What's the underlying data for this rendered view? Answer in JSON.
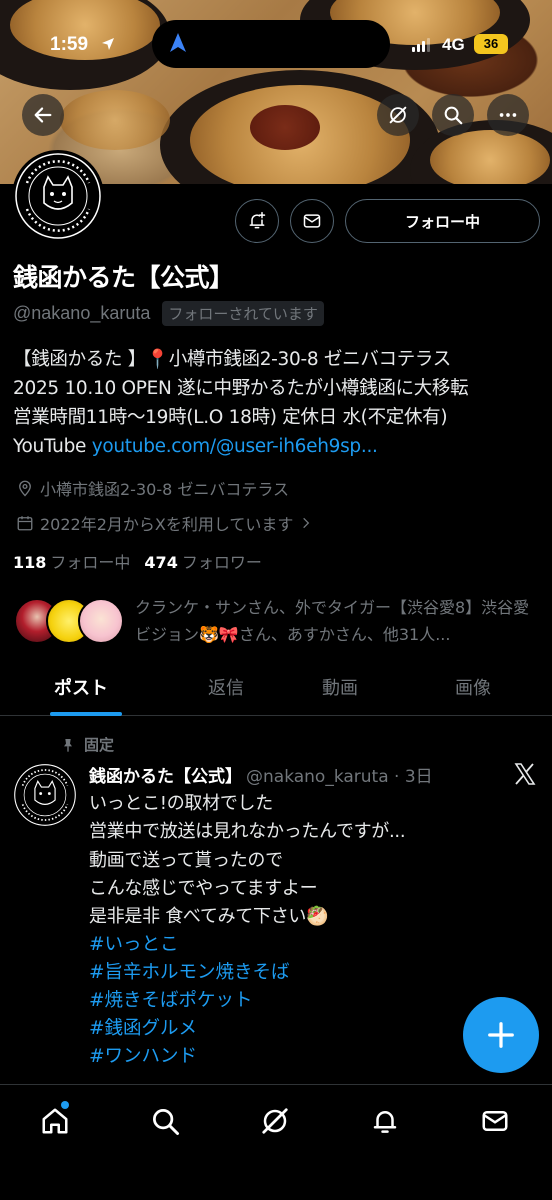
{
  "status": {
    "time": "1:59",
    "network": "4G",
    "battery": "36"
  },
  "profile": {
    "name": "銭函かるた【公式】",
    "handle": "@nakano_karuta",
    "follows_you": "フォローされています",
    "follow_button": "フォロー中",
    "bio": "【銭函かるた 】📍小樽市銭函2-30-8 ゼニバコテラス\n2025 10.10 OPEN 遂に中野かるたが小樽銭函に大移転\n営業時間11時〜19時(L.O 18時) 定休日 水(不定休有)\nYouTube ",
    "bio_link": "youtube.com/@user-ih6eh9sp...",
    "location": "小樽市銭函2-30-8 ゼニバコテラス",
    "joined": "2022年2月からXを利用しています",
    "following_count": "118",
    "following_label": "フォロー中",
    "followers_count": "474",
    "followers_label": "フォロワー",
    "followers_you_know": "クランケ・サンさん、外でタイガー【渋谷愛8】渋谷愛ビジョン🐯🎀さん、あすかさん、他31人..."
  },
  "tabs": [
    "ポスト",
    "返信",
    "動画",
    "画像"
  ],
  "post": {
    "pinned_label": "固定",
    "author_name": "銭函かるた【公式】",
    "author_handle_time": "@nakano_karuta · 3日",
    "body": "いっとこ!の取材でした\n営業中で放送は見れなかったんですが...\n動画で送って貰ったので\nこんな感じでやってますよー\n是非是非 食べてみて下さい🥙",
    "hashtags": [
      "#いっとこ",
      "#旨辛ホルモン焼きそば",
      "#焼きそばポケット",
      "#銭函グルメ",
      "#ワンハンド"
    ]
  },
  "colors": {
    "accent": "#1d9bf0",
    "muted": "#71767b",
    "battery": "#f3c51e"
  },
  "icons": {
    "back": "arrow-left-icon",
    "grok": "grok-icon",
    "search": "search-icon",
    "more": "more-icon",
    "notify": "bell-plus-icon",
    "message": "envelope-icon",
    "location": "location-pin-icon",
    "calendar": "calendar-icon",
    "pin": "pin-icon",
    "compose": "plus-icon",
    "nav": [
      "home-icon",
      "search-icon",
      "grok-icon",
      "bell-icon",
      "envelope-icon"
    ]
  }
}
